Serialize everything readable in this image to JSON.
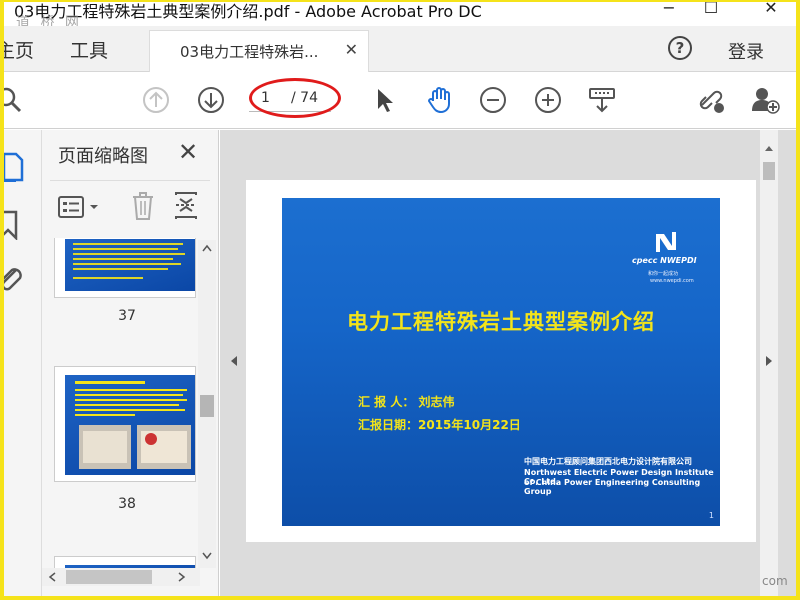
{
  "window": {
    "title": "03电力工程特殊岩土典型案例介绍.pdf - Adobe Acrobat Pro DC",
    "watermark": "道 桥 网",
    "minimize": "−",
    "maximize": "☐",
    "close": "✕"
  },
  "tabs": {
    "home": "主页",
    "tools": "工具",
    "document": "03电力工程特殊岩...",
    "document_close": "✕",
    "help": "?",
    "login": "登录"
  },
  "toolbar": {
    "current_page": "1",
    "total_pages": "/ 74"
  },
  "panel": {
    "title": "页面缩略图",
    "close": "✕",
    "thumbnails": [
      {
        "label": "37"
      },
      {
        "label": "38"
      }
    ]
  },
  "slide": {
    "title": "电力工程特殊岩土典型案例介绍",
    "reporter": "汇 报 人：  刘志伟",
    "date": "汇报日期：2015年10月22日",
    "company_cn": "中国电力工程顾问集团西北电力设计院有限公司",
    "company_en_1": "Northwest Electric Power Design Institute Co, Ltd.",
    "company_en_2": "of China Power Engineering Consulting Group",
    "page_number": "1",
    "logo_brand": "cpecc NWEPDI",
    "logo_slogan": "和你一起成功",
    "logo_url": "www.nwepdi.com"
  },
  "corner_watermark": "com",
  "colors": {
    "accent_frame": "#f5e31a",
    "slide_title": "#f3e41a",
    "slide_bg": "#1565c8",
    "annotation_red": "#e01b1b"
  }
}
